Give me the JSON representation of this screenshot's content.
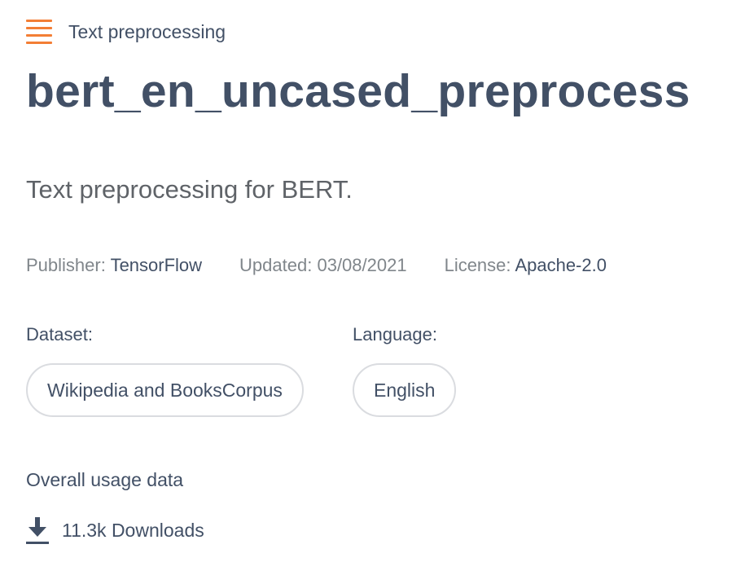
{
  "header": {
    "category_icon": "list-icon",
    "category_label": "Text preprocessing",
    "accent_color": "#f37e35"
  },
  "model": {
    "title": "bert_en_uncased_preprocess",
    "description": "Text preprocessing for BERT."
  },
  "meta": {
    "publisher_key": "Publisher:",
    "publisher_value": "TensorFlow",
    "updated_key": "Updated:",
    "updated_value": "03/08/2021",
    "license_key": "License:",
    "license_value": "Apache-2.0"
  },
  "dataset": {
    "label": "Dataset:",
    "chips": [
      "Wikipedia and BooksCorpus"
    ]
  },
  "language": {
    "label": "Language:",
    "chips": [
      "English"
    ]
  },
  "usage": {
    "label": "Overall usage data",
    "icon": "download-icon",
    "downloads": "11.3k Downloads"
  }
}
